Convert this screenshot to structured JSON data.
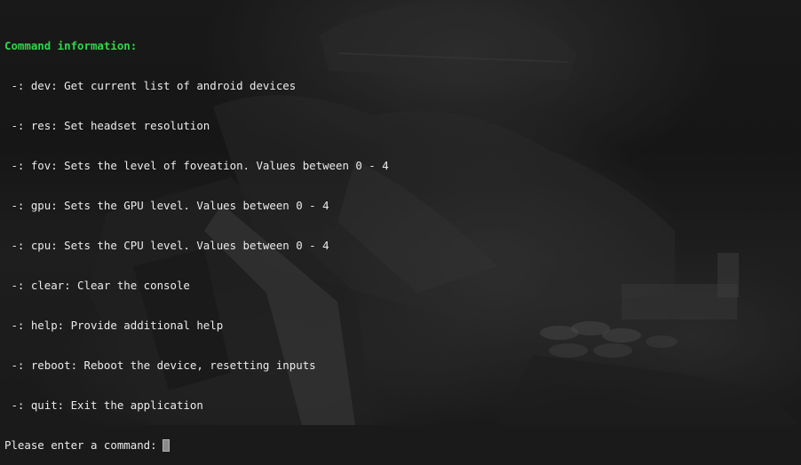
{
  "terminal": {
    "heading": "Command information:",
    "commands": [
      " -: dev: Get current list of android devices",
      " -: res: Set headset resolution",
      " -: fov: Sets the level of foveation. Values between 0 - 4",
      " -: gpu: Sets the GPU level. Values between 0 - 4",
      " -: cpu: Sets the CPU level. Values between 0 - 4",
      " -: clear: Clear the console",
      " -: help: Provide additional help",
      " -: reboot: Reboot the device, resetting inputs",
      " -: quit: Exit the application"
    ],
    "prompt": "Please enter a command:",
    "input_value": ""
  },
  "colors": {
    "heading": "#2fd84a",
    "text": "#ececec",
    "cursor": "#8a8a8a"
  }
}
